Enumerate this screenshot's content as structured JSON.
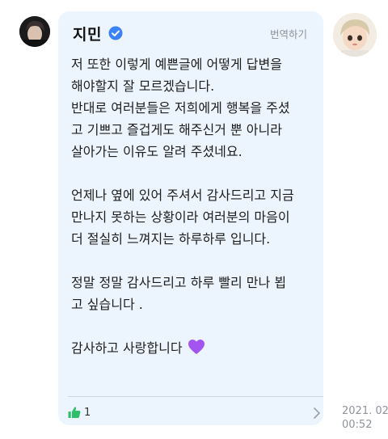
{
  "author": {
    "name": "지민",
    "avatar_icon": "user-avatar-photo",
    "verified_icon": "verified-badge-icon",
    "verified_color": "#3b82f6"
  },
  "fan": {
    "avatar_icon": "fan-avatar-cartoon"
  },
  "translate_label": "번역하기",
  "message": {
    "paragraphs": [
      [
        "저 또한 이렇게 예쁜글에 어떻게 답변을",
        "해야할지 잘 모르겠습니다.",
        "반대로 여러분들은 저희에게 행복을 주셨",
        "고 기쁘고 즐겁게도 해주신거 뿐 아니라",
        "살아가는 이유도 알려 주셨네요."
      ],
      [
        "언제나 옆에 있어 주셔서 감사드리고 지금",
        "만나지 못하는 상황이라 여러분의 마음이",
        "더 절실히 느껴지는 하루하루 입니다."
      ],
      [
        "정말 정말 감사드리고 하루 빨리 만나 뵙",
        "고 싶습니다 ."
      ],
      [
        "감사하고 사랑합니다"
      ]
    ],
    "emoji": "purple-heart"
  },
  "like": {
    "icon": "thumbs-up-icon",
    "count": "1",
    "color": "#2ebf6b"
  },
  "more_icon": "chevron-right-icon",
  "timestamp": {
    "date": "2021. 02",
    "time": "00:52"
  },
  "colors": {
    "bubble": "#ecf4fd",
    "heart": "#a355f0"
  }
}
